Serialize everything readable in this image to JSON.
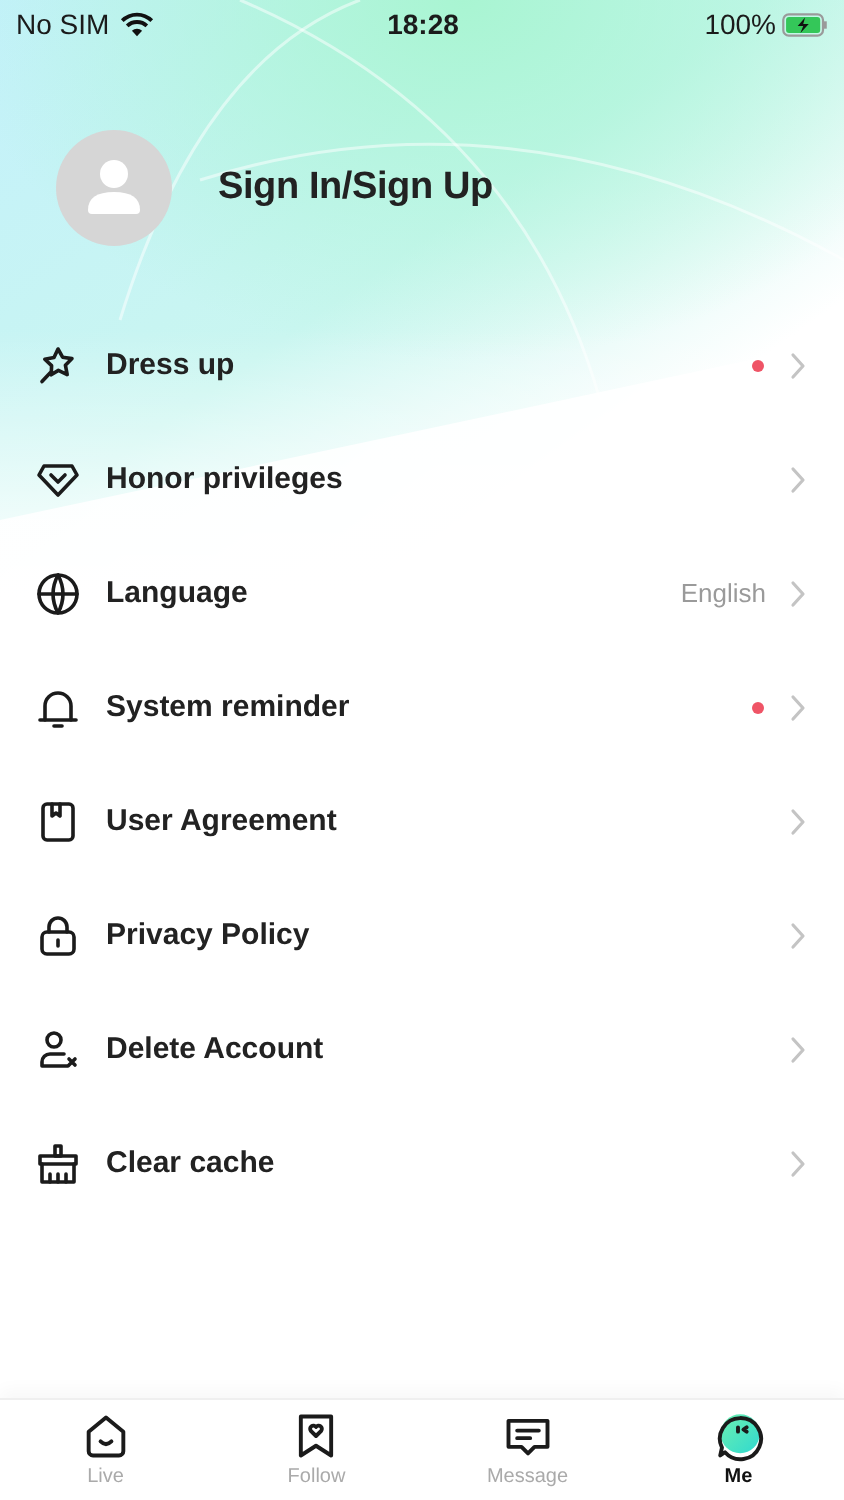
{
  "status_bar": {
    "carrier": "No SIM",
    "time": "18:28",
    "battery": "100%"
  },
  "profile": {
    "label": "Sign In/Sign Up"
  },
  "menu": [
    {
      "label": "Dress up",
      "unread": true
    },
    {
      "label": "Honor privileges",
      "unread": false
    },
    {
      "label": "Language",
      "value": "English",
      "unread": false
    },
    {
      "label": "System reminder",
      "unread": true
    },
    {
      "label": "User Agreement",
      "unread": false
    },
    {
      "label": "Privacy Policy",
      "unread": false
    },
    {
      "label": "Delete Account",
      "unread": false
    },
    {
      "label": "Clear cache",
      "unread": false
    }
  ],
  "tabs": [
    {
      "label": "Live",
      "selected": false
    },
    {
      "label": "Follow",
      "selected": false
    },
    {
      "label": "Message",
      "selected": false
    },
    {
      "label": "Me",
      "selected": true
    }
  ]
}
